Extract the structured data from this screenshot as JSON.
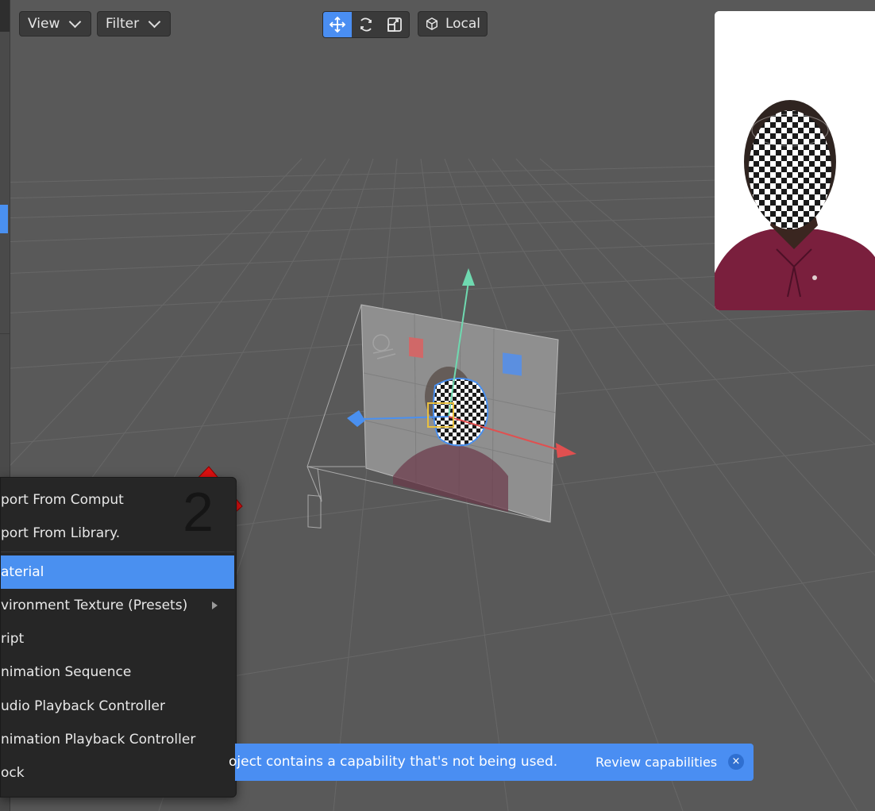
{
  "toolbar": {
    "view_label": "View",
    "filter_label": "Filter",
    "tools": [
      {
        "icon": "move-icon",
        "active": true
      },
      {
        "icon": "rotate-icon",
        "active": false
      },
      {
        "icon": "scale-icon",
        "active": false
      }
    ],
    "space_label": "Local",
    "space_icon": "cube-icon"
  },
  "context_menu": {
    "items": [
      {
        "label": "port From Comput",
        "selected": false
      },
      {
        "label": "port From Library.",
        "selected": false
      },
      {
        "label": "aterial",
        "selected": true
      },
      {
        "label": "vironment Texture (Presets)",
        "selected": false,
        "has_submenu": true
      },
      {
        "label": "ript",
        "selected": false
      },
      {
        "label": "nimation Sequence",
        "selected": false
      },
      {
        "label": "udio Playback Controller",
        "selected": false
      },
      {
        "label": "nimation Playback Controller",
        "selected": false
      },
      {
        "label": "ock",
        "selected": false
      }
    ]
  },
  "annotation": {
    "number": "2",
    "color": "#e01010"
  },
  "notification": {
    "message": "oject contains a capability that's not being used.",
    "link": "Review capabilities",
    "close": "×"
  },
  "colors": {
    "accent": "#4a8ef2",
    "gizmo_x": "#e05050",
    "gizmo_y": "#60d0a0",
    "gizmo_z": "#4a90f0"
  }
}
